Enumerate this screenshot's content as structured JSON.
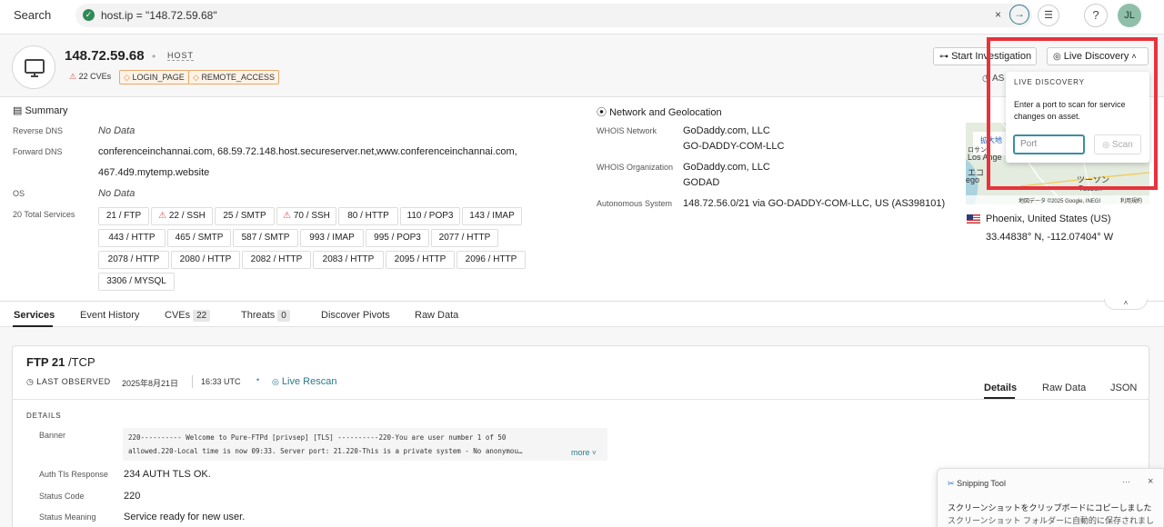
{
  "topbar": {
    "search_label": "Search",
    "query": "host.ip = \"148.72.59.68\"",
    "clear": "×",
    "go": "→",
    "filter": "☰",
    "help": "?",
    "avatar_initials": "JL"
  },
  "host": {
    "ip": "148.72.59.68",
    "type": "HOST",
    "cves_badge": "22 CVEs",
    "badges": [
      "LOGIN_PAGE",
      "REMOTE_ACCESS"
    ],
    "start_investigation": "Start Investigation",
    "live_discovery": "Live Discovery",
    "as_fragment": "AS"
  },
  "live_discovery_popup": {
    "title": "LIVE DISCOVERY",
    "text": "Enter a port to scan for service changes on asset.",
    "port_placeholder": "Port",
    "scan_label": "Scan"
  },
  "summary": {
    "title": "Summary",
    "reverse_dns_label": "Reverse DNS",
    "reverse_dns_value": "No Data",
    "forward_dns_label": "Forward DNS",
    "forward_dns": [
      "conferenceinchannai.com,",
      "68.59.72.148.host.secureserver.net,",
      "www.conferenceinchannai.com,",
      "467.4d9.mytemp.website"
    ],
    "os_label": "OS",
    "os_value": "No Data",
    "services_label": "20 Total Services",
    "services": [
      [
        "21 / FTP",
        "22 / SSH",
        "25 / SMTP",
        "70 / SSH",
        "80 / HTTP",
        "110 / POP3",
        "143 / IMAP"
      ],
      [
        "443 / HTTP",
        "465 / SMTP",
        "587 / SMTP",
        "993 / IMAP",
        "995 / POP3",
        "2077 / HTTP"
      ],
      [
        "2078 / HTTP",
        "2080 / HTTP",
        "2082 / HTTP",
        "2083 / HTTP",
        "2095 / HTTP",
        "2096 / HTTP"
      ],
      [
        "3306 / MYSQL"
      ]
    ]
  },
  "network": {
    "title": "Network and Geolocation",
    "whois_network_label": "WHOIS Network",
    "whois_network": [
      "GoDaddy.com, LLC",
      "GO-DADDY-COM-LLC"
    ],
    "whois_org_label": "WHOIS Organization",
    "whois_org": [
      "GoDaddy.com, LLC",
      "GODAD"
    ],
    "asys_label": "Autonomous System",
    "asys_value": "148.72.56.0/21 via GO-DADDY-COM-LLC, US (AS398101)",
    "location": "Phoenix, United States (US)",
    "coords": "33.44838° N, -112.07404° W",
    "map_labels": {
      "a": "拡大地",
      "b": "Los Ange",
      "c": "エコ",
      "d": "ego",
      "e": "ツーソン",
      "f": "Tucson",
      "g": "ロサン",
      "copyright": "地図データ ©2025 Google, INEGI",
      "terms": "利用規約"
    }
  },
  "tabs": [
    {
      "label": "Services",
      "count": ""
    },
    {
      "label": "Event History",
      "count": ""
    },
    {
      "label": "CVEs",
      "count": "22"
    },
    {
      "label": "Threats",
      "count": "0"
    },
    {
      "label": "Discover Pivots",
      "count": ""
    },
    {
      "label": "Raw Data",
      "count": ""
    }
  ],
  "service_card": {
    "title_strong": "FTP 21",
    "title_suffix": " /TCP",
    "last_observed_label": "LAST OBSERVED",
    "date": "2025年8月21日",
    "time": "16:33 UTC",
    "live_rescan": "Live Rescan",
    "view_tabs": [
      "Details",
      "Raw Data",
      "JSON"
    ],
    "details_title": "DETAILS",
    "banner_label": "Banner",
    "banner_line1": "220---------- Welcome to Pure-FTPd [privsep] [TLS] ----------220-You are user number 1 of 50",
    "banner_line2": "allowed.220-Local time is now 09:33. Server port: 21.220-This is a private system - No anonymou…",
    "more": "more",
    "auth_label": "Auth Tls Response",
    "auth_value": "234 AUTH TLS OK.",
    "status_code_label": "Status Code",
    "status_code_value": "220",
    "status_meaning_label": "Status Meaning",
    "status_meaning_value": "Service ready for new user."
  },
  "toast": {
    "app": "Snipping Tool",
    "line1": "スクリーンショットをクリップボードにコピーしました",
    "line2": "スクリーンショット フォルダーに自動的に保存されました。",
    "dots": "···",
    "close": "×"
  }
}
